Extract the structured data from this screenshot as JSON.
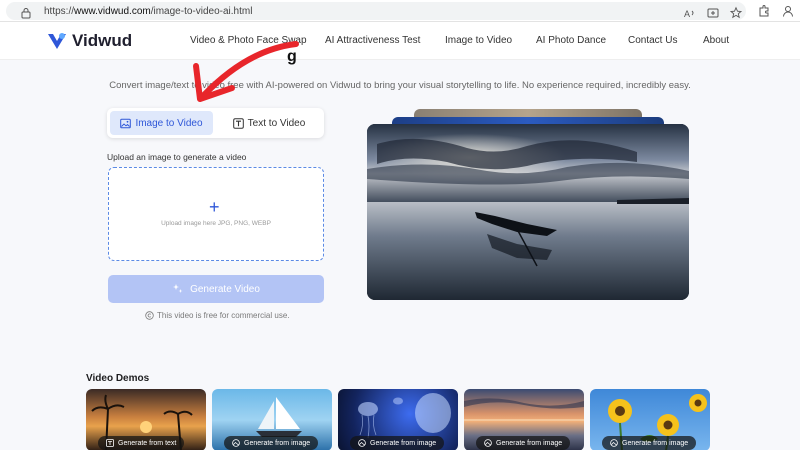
{
  "browser": {
    "url_prefix": "https://",
    "url_host": "www.vidwud.com",
    "url_path": "/image-to-video-ai.html"
  },
  "header": {
    "logo": "Vidwud",
    "nav": [
      "Video & Photo Face Swap",
      "AI Attractiveness Test",
      "Image to Video",
      "AI Photo Dance",
      "Contact Us",
      "About"
    ]
  },
  "hero": {
    "title_fragment": "g",
    "intro": "Convert image/text to video free with AI-powered on Vidwud to bring your visual storytelling to life. No experience required, incredibly easy."
  },
  "tabs": {
    "image_to_video": "Image to Video",
    "text_to_video": "Text to Video",
    "active": "Image to Video"
  },
  "upload": {
    "label": "Upload an image to generate a video",
    "hint": "Upload image here JPG, PNG, WEBP"
  },
  "generate": {
    "label": "Generate Video",
    "note": "This video is free for commercial use."
  },
  "demos": {
    "title": "Video Demos",
    "cards": [
      {
        "caption": "Generate from text",
        "icon": "text-icon"
      },
      {
        "caption": "Generate from image",
        "icon": "image-icon"
      },
      {
        "caption": "Generate from image",
        "icon": "image-icon"
      },
      {
        "caption": "Generate from image",
        "icon": "image-icon"
      },
      {
        "caption": "Generate from image",
        "icon": "image-icon"
      }
    ]
  },
  "colors": {
    "accent": "#2f57d8",
    "active_tab_bg": "#dfe8fb",
    "button_disabled": "#b3c4f5",
    "annotation_arrow": "#e8262b"
  }
}
